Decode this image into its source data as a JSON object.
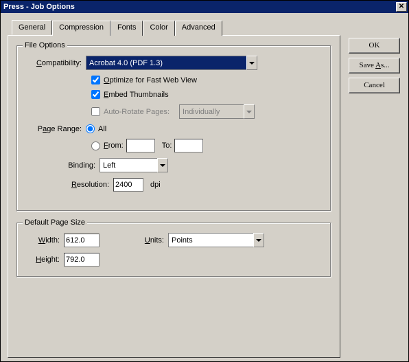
{
  "window": {
    "title": "Press - Job Options"
  },
  "tabs": [
    "General",
    "Compression",
    "Fonts",
    "Color",
    "Advanced"
  ],
  "buttons": {
    "ok": "OK",
    "saveas": "Save As...",
    "cancel": "Cancel"
  },
  "fileOptions": {
    "legend": "File Options",
    "compatibility_label": "Compatibility:",
    "compatibility_value": "Acrobat 4.0 (PDF 1.3)",
    "optimize_label": "Optimize for Fast Web View",
    "embed_label": "Embed Thumbnails",
    "autorotate_label": "Auto-Rotate Pages:",
    "autorotate_value": "Individually",
    "pagerange_label": "Page Range:",
    "all_label": "All",
    "from_label": "From:",
    "to_label": "To:",
    "binding_label": "Binding:",
    "binding_value": "Left",
    "resolution_label": "Resolution:",
    "resolution_value": "2400",
    "resolution_unit": "dpi"
  },
  "defaultPage": {
    "legend": "Default Page Size",
    "width_label": "Width:",
    "width_value": "612.0",
    "height_label": "Height:",
    "height_value": "792.0",
    "units_label": "Units:",
    "units_value": "Points"
  }
}
